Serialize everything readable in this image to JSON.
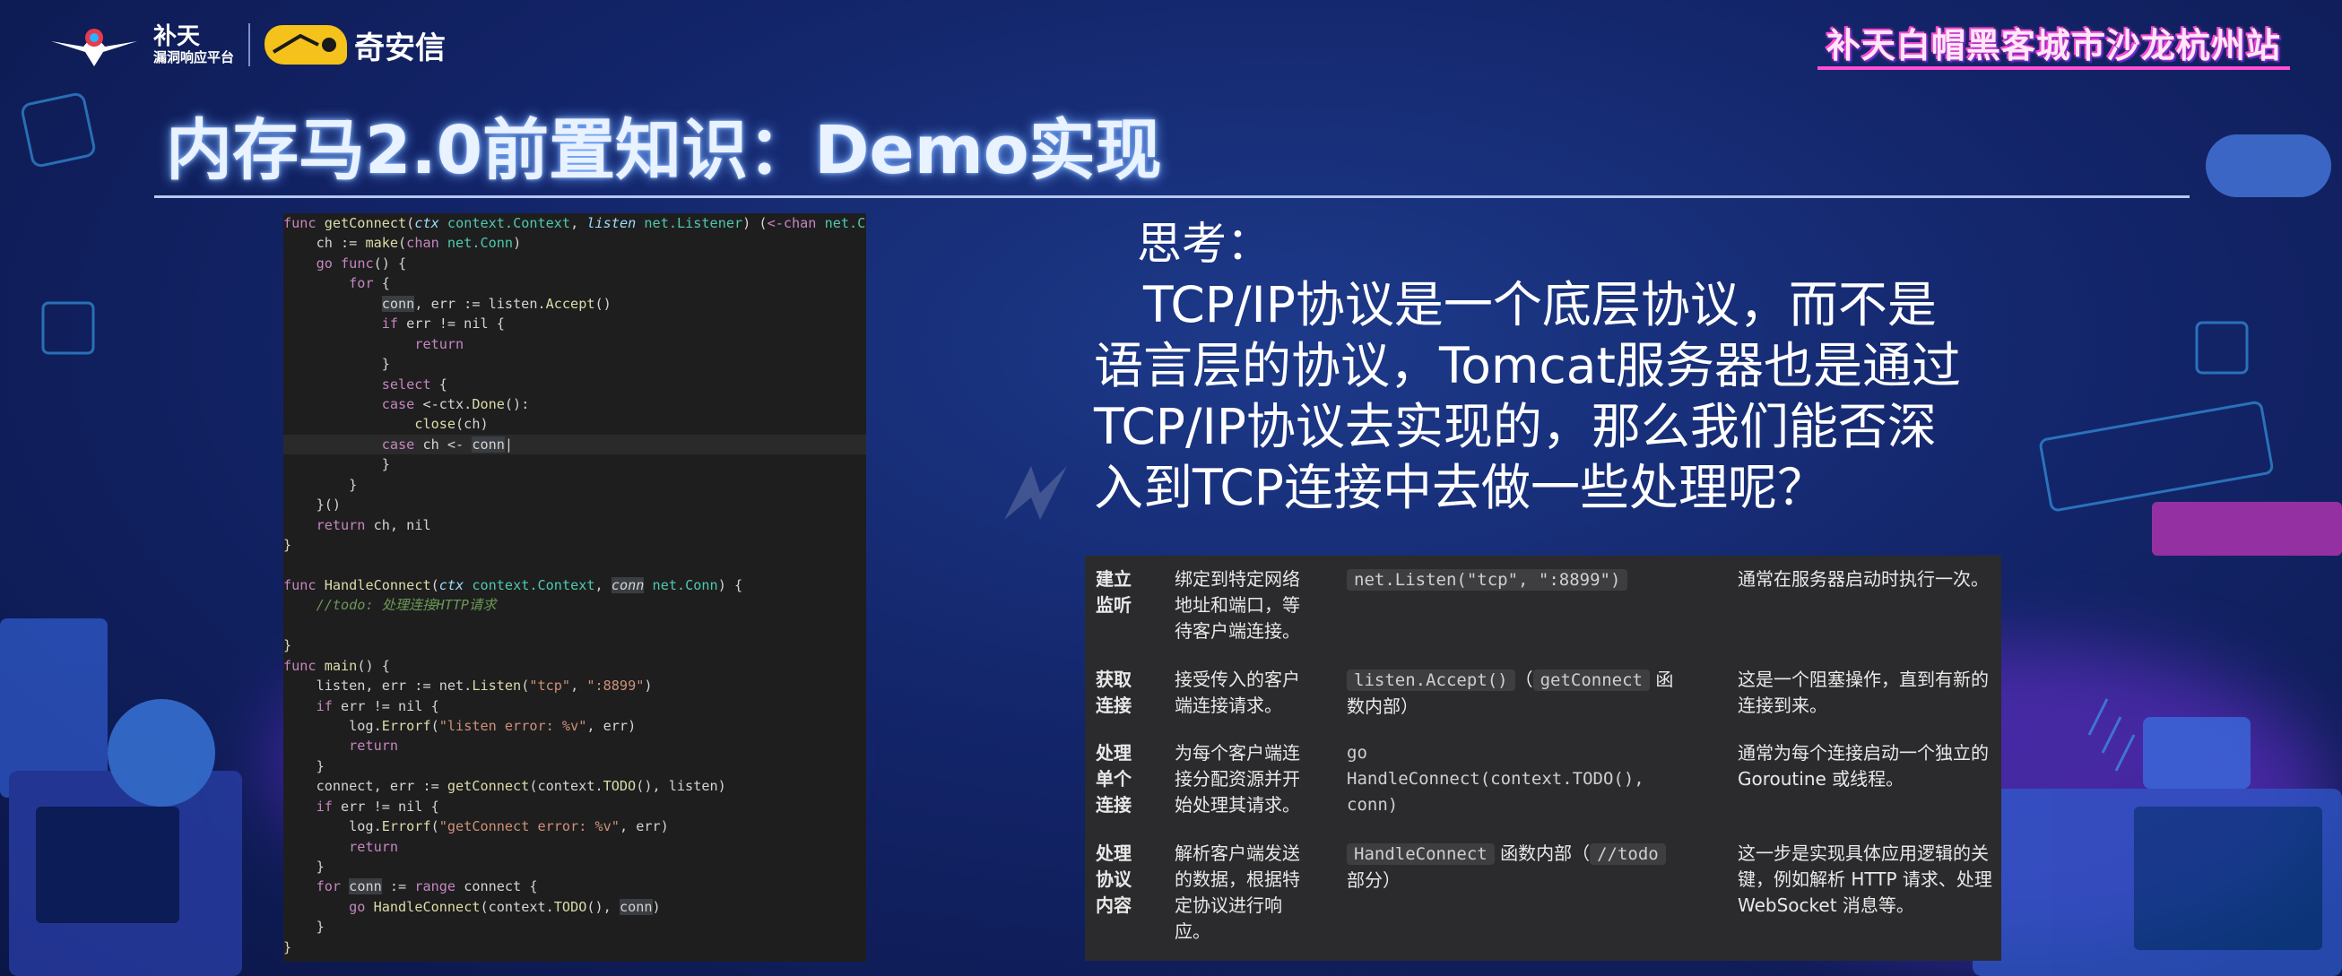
{
  "header": {
    "brand_main": "补天",
    "brand_sub": "漏洞响应平台",
    "partner": "奇安信",
    "event": "补天白帽黑客城市沙龙杭州站"
  },
  "title": "内存马2.0前置知识：Demo实现",
  "code_lines": [
    "func getConnect(ctx context.Context, listen net.Listener) (<-chan net.Conn",
    "    ch := make(chan net.Conn)",
    "    go func() {",
    "        for {",
    "            conn, err := listen.Accept()",
    "            if err != nil {",
    "                return",
    "            }",
    "            select {",
    "            case <-ctx.Done():",
    "                close(ch)",
    "            case ch <- conn",
    "            }",
    "        }",
    "    }()",
    "    return ch, nil",
    "}",
    "",
    "func HandleConnect(ctx context.Context, conn net.Conn) {",
    "    //todo: 处理连接HTTP请求",
    "",
    "}",
    "func main() {",
    "    listen, err := net.Listen(\"tcp\", \":8899\")",
    "    if err != nil {",
    "        log.Errorf(\"listen error: %v\", err)",
    "        return",
    "    }",
    "    connect, err := getConnect(context.TODO(), listen)",
    "    if err != nil {",
    "        log.Errorf(\"getConnect error: %v\", err)",
    "        return",
    "    }",
    "    for conn := range connect {",
    "        go HandleConnect(context.TODO(), conn)",
    "    }",
    "}"
  ],
  "thinking": {
    "label": "思考：",
    "lines": [
      "　TCP/IP协议是一个底层协议，而不是",
      "语言层的协议，Tomcat服务器也是通过",
      "TCP/IP协议去实现的，那么我们能否深",
      "入到TCP连接中去做一些处理呢？"
    ]
  },
  "steps": [
    {
      "name": [
        "建立",
        "监听"
      ],
      "desc": [
        "绑定到特定网络",
        "地址和端口，等",
        "待客户端连接。"
      ],
      "code": "net.Listen(\"tcp\", \":8899\")",
      "note": [
        "通常在服务器启动时执行一次。"
      ]
    },
    {
      "name": [
        "获取",
        "连接"
      ],
      "desc": [
        "接受传入的客户",
        "端连接请求。"
      ],
      "code": "listen.Accept()",
      "code_open": "（",
      "code_fn": "getConnect",
      "code_fn_suffix": " 函",
      "code_tail": "数内部）",
      "note": [
        "这是一个阻塞操作，直到有新的",
        "连接到来。"
      ]
    },
    {
      "name": [
        "处理",
        "单个",
        "连接"
      ],
      "desc": [
        "为每个客户端连",
        "接分配资源并开",
        "始处理其请求。"
      ],
      "code_lines": [
        "go",
        "HandleConnect(context.TODO(),",
        "conn)"
      ],
      "note": [
        "通常为每个连接启动一个独立的",
        "Goroutine 或线程。"
      ]
    },
    {
      "name": [
        "处理",
        "协议",
        "内容"
      ],
      "desc": [
        "解析客户端发送",
        "的数据，根据特",
        "定协议进行响",
        "应。"
      ],
      "code": "HandleConnect",
      "code_mid": " 函数内部（",
      "code_todo": "//todo",
      "code_tail": "部分）",
      "note": [
        "这一步是实现具体应用逻辑的关",
        "键，例如解析 HTTP 请求、处理",
        "WebSocket 消息等。"
      ]
    }
  ],
  "colors": {
    "background": "#13256a",
    "code_bg": "#1e1e1e",
    "table_bg": "#2b2b2d",
    "title_glow": "#6fa7ff",
    "accent_pink": "#ff4fd6"
  }
}
